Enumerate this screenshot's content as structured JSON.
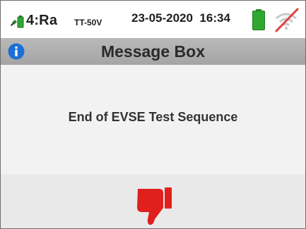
{
  "status": {
    "mode": "4:Ra",
    "system": "TT-50V",
    "date": "23-05-2020",
    "time": "16:34",
    "icons": [
      "plug-battery-icon",
      "battery-full-icon",
      "wifi-off-icon"
    ],
    "colors": {
      "battery": "#2fa82f",
      "wifi_slash": "#e0403a",
      "wifi": "#c9c9c9"
    }
  },
  "header": {
    "title": "Message Box",
    "icon": "info-icon",
    "colors": {
      "info": "#1c6fd6"
    }
  },
  "message": {
    "text": "End of EVSE Test Sequence"
  },
  "result": {
    "icon": "thumbs-down-icon",
    "color": "#e0201c"
  }
}
